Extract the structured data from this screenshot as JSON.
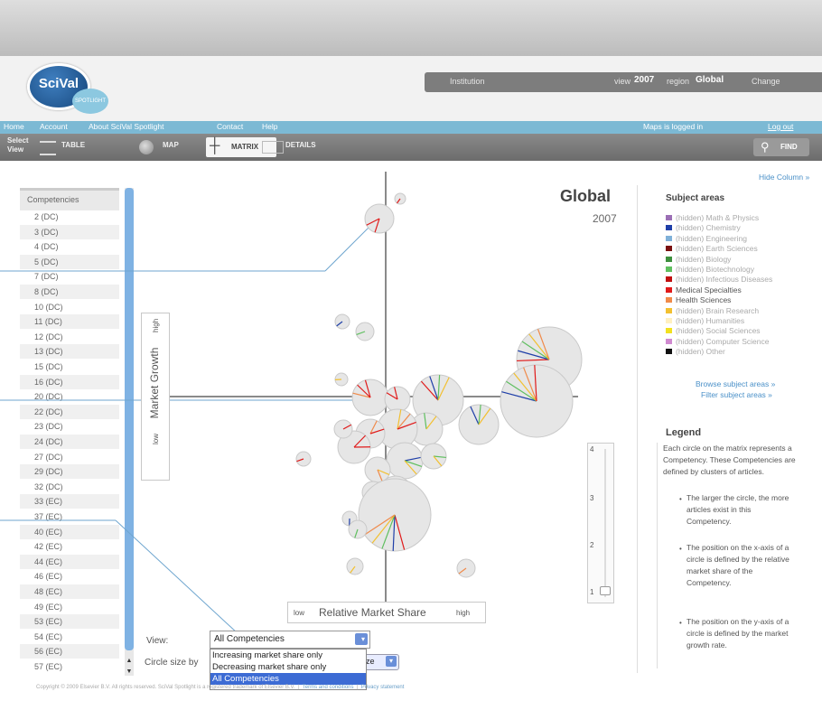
{
  "app": {
    "logo_text": "SciVal",
    "logo_sub": "SPOTLIGHT"
  },
  "header": {
    "institution_label": "Institution",
    "view_label": "view",
    "view_year": "2007",
    "region_label": "region",
    "region_value": "Global",
    "change_label": "Change"
  },
  "nav": {
    "items": [
      "Home",
      "Account",
      "About SciVal Spotlight",
      "Contact",
      "Help"
    ],
    "logged_in": "Maps is logged in",
    "logout": "Log out"
  },
  "toolbar": {
    "select_view": "Select View",
    "table": "TABLE",
    "map": "MAP",
    "matrix": "MATRIX",
    "details": "DETAILS",
    "find": "FIND"
  },
  "competencies": {
    "heading": "Competencies",
    "items": [
      "2 (DC)",
      "3 (DC)",
      "4 (DC)",
      "5 (DC)",
      "7 (DC)",
      "8 (DC)",
      "10 (DC)",
      "11 (DC)",
      "12 (DC)",
      "13 (DC)",
      "15 (DC)",
      "16 (DC)",
      "20 (DC)",
      "22 (DC)",
      "23 (DC)",
      "24 (DC)",
      "27 (DC)",
      "29 (DC)",
      "32 (DC)",
      "33 (EC)",
      "37 (EC)",
      "40 (EC)",
      "42 (EC)",
      "44 (EC)",
      "46 (EC)",
      "48 (EC)",
      "49 (EC)",
      "53 (EC)",
      "54 (EC)",
      "56 (EC)",
      "57 (EC)"
    ]
  },
  "matrix": {
    "title": "Global",
    "year": "2007",
    "y_axis": "Market Growth",
    "y_low": "low",
    "y_high": "high",
    "x_axis": "Relative Market Share",
    "x_low": "low",
    "x_high": "high",
    "slider_ticks": [
      "4",
      "3",
      "2",
      "1"
    ]
  },
  "subject_areas": {
    "hide_column": "Hide Column »",
    "heading": "Subject areas",
    "items": [
      {
        "label": "(hidden) Math & Physics",
        "color": "#9b6fb5",
        "on": false
      },
      {
        "label": "(hidden) Chemistry",
        "color": "#1f3fa8",
        "on": false
      },
      {
        "label": "(hidden) Engineering",
        "color": "#7fb0d8",
        "on": false
      },
      {
        "label": "(hidden) Earth Sciences",
        "color": "#7a1010",
        "on": false
      },
      {
        "label": "(hidden) Biology",
        "color": "#3d8f3d",
        "on": false
      },
      {
        "label": "(hidden) Biotechnology",
        "color": "#5fbf5f",
        "on": false
      },
      {
        "label": "(hidden) Infectious Diseases",
        "color": "#c01010",
        "on": false
      },
      {
        "label": "Medical Specialties",
        "color": "#e01a1a",
        "on": true
      },
      {
        "label": "Health Sciences",
        "color": "#f08a4a",
        "on": true
      },
      {
        "label": "(hidden) Brain Research",
        "color": "#f2c030",
        "on": false
      },
      {
        "label": "(hidden) Humanities",
        "color": "#fff0c0",
        "on": false
      },
      {
        "label": "(hidden) Social Sciences",
        "color": "#f2e020",
        "on": false
      },
      {
        "label": "(hidden) Computer Science",
        "color": "#d08ad0",
        "on": false
      },
      {
        "label": "(hidden) Other",
        "color": "#111111",
        "on": false
      }
    ],
    "browse_link": "Browse subject areas »",
    "filter_link": "Filter subject areas »"
  },
  "legend": {
    "heading": "Legend",
    "intro": "Each circle on the matrix represents a Competency. These Competencies are defined by clusters of articles.",
    "bullets": [
      "The larger the circle, the more articles exist in this Competency.",
      "The position on the x-axis of a circle is defined by the relative market share of the Competency.",
      "The position on the y-axis of a circle is defined by the market growth rate."
    ]
  },
  "controls": {
    "view_label": "View:",
    "view_value": "All Competencies",
    "view_options": [
      "Increasing market share only",
      "Decreasing market share only",
      "All Competencies"
    ],
    "circle_size_label": "Circle size by",
    "circle_size_value": "ze"
  },
  "footer": {
    "copyright": "Copyright © 2009 Elsevier B.V. All rights reserved. SciVal Spotlight is a registered trademark of Elsevier B.V.",
    "terms": "Terms and conditions",
    "privacy": "Privacy statement"
  }
}
